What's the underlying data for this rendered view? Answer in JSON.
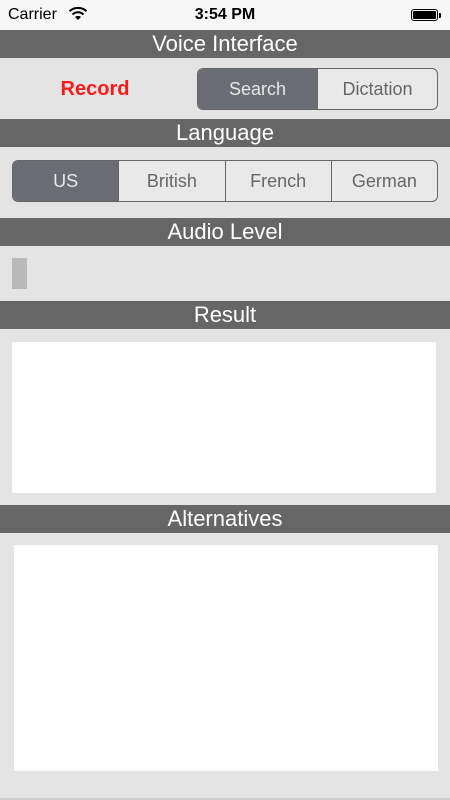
{
  "status_bar": {
    "carrier": "Carrier",
    "time": "3:54 PM",
    "wifi_icon": "wifi-icon",
    "battery_icon": "battery-icon",
    "battery_level": 1.0
  },
  "sections": {
    "voice_interface": "Voice Interface",
    "language": "Language",
    "audio_level": "Audio Level",
    "result": "Result",
    "alternatives": "Alternatives"
  },
  "record_button": "Record",
  "mode_segments": {
    "items": [
      "Search",
      "Dictation"
    ],
    "selected": "Search"
  },
  "language_segments": {
    "items": [
      "US",
      "British",
      "French",
      "German"
    ],
    "selected": "US"
  },
  "audio_level": 0.0,
  "result_text": "",
  "alternatives_text": "",
  "colors": {
    "header_bg": "#666666",
    "record": "#ff1a1a",
    "segment_selected": "#6a6d74",
    "background": "#e4e4e4"
  }
}
